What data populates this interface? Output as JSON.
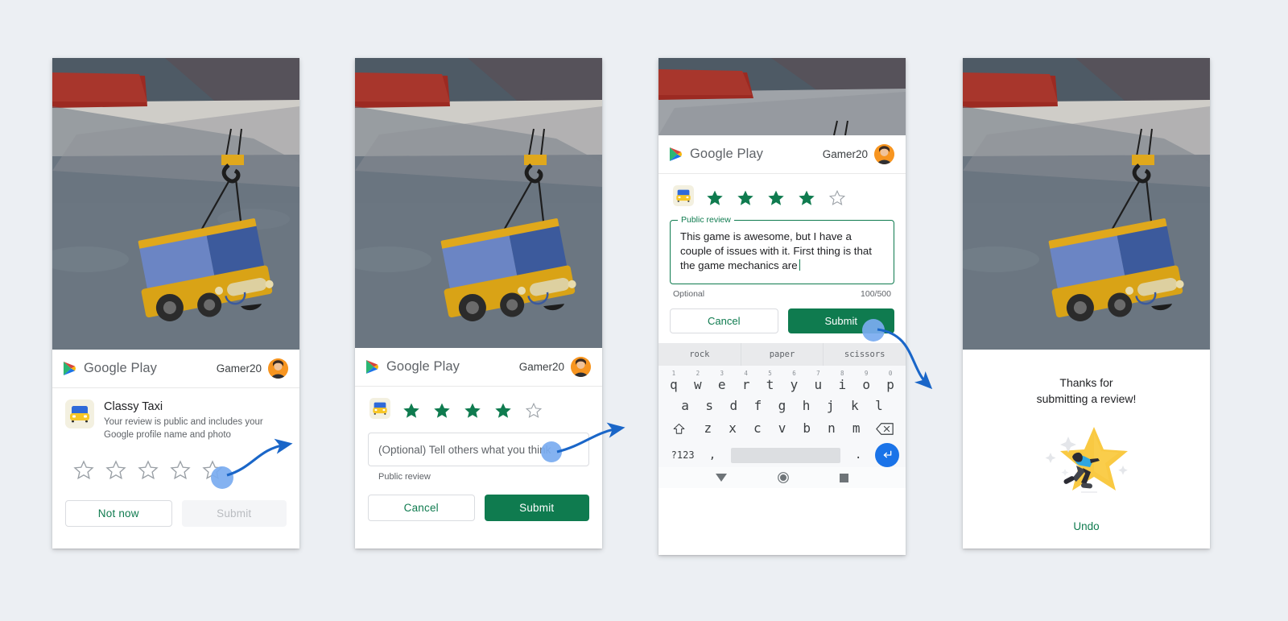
{
  "meta": {
    "accent_green": "#0f7b4f",
    "arrow_blue": "#1a66c8",
    "touch_blue": "#7aabf0",
    "star_gold": "#f9c942",
    "background": "#eceff3"
  },
  "panel1": {
    "name": "rating-prompt",
    "appbar": {
      "brand": "Google Play",
      "username": "Gamer20",
      "logo_icon": "google-play-logo",
      "avatar_icon": "user-avatar"
    },
    "app": {
      "icon": "classy-taxi-app-icon",
      "title": "Classy Taxi",
      "subtitle": "Your review is public and includes your Google profile name and photo"
    },
    "rating": {
      "value": 0,
      "max": 5,
      "stars": [
        "empty",
        "empty",
        "empty",
        "empty",
        "empty"
      ]
    },
    "buttons": {
      "secondary": "Not now",
      "primary": "Submit",
      "primary_disabled": true
    }
  },
  "panel2": {
    "name": "review-entry-empty",
    "appbar": {
      "brand": "Google Play",
      "username": "Gamer20",
      "logo_icon": "google-play-logo",
      "avatar_icon": "user-avatar"
    },
    "rating": {
      "value": 4,
      "max": 5,
      "stars": [
        "filled",
        "filled",
        "filled",
        "filled",
        "empty"
      ],
      "app_icon": "classy-taxi-app-icon"
    },
    "input": {
      "placeholder": "(Optional) Tell others what you think",
      "value": "",
      "helper": "Public review"
    },
    "buttons": {
      "secondary": "Cancel",
      "primary": "Submit"
    }
  },
  "panel3": {
    "name": "review-entry-typing",
    "appbar": {
      "brand": "Google Play",
      "username": "Gamer20",
      "logo_icon": "google-play-logo",
      "avatar_icon": "user-avatar"
    },
    "rating": {
      "value": 4,
      "max": 5,
      "stars": [
        "filled",
        "filled",
        "filled",
        "filled",
        "empty"
      ],
      "app_icon": "classy-taxi-app-icon"
    },
    "field": {
      "label": "Public review",
      "value": "This game is awesome, but I have a couple of issues with it. First thing is that the game mechanics are",
      "helper": "Optional",
      "counter": "100/500"
    },
    "buttons": {
      "secondary": "Cancel",
      "primary": "Submit"
    },
    "keyboard": {
      "suggestions": [
        "rock",
        "paper",
        "scissors"
      ],
      "row1_numbers": [
        "1",
        "2",
        "3",
        "4",
        "5",
        "6",
        "7",
        "8",
        "9",
        "0"
      ],
      "row1": [
        "q",
        "w",
        "e",
        "r",
        "t",
        "y",
        "u",
        "i",
        "o",
        "p"
      ],
      "row2": [
        "a",
        "s",
        "d",
        "f",
        "g",
        "h",
        "j",
        "k",
        "l"
      ],
      "row3": [
        "z",
        "x",
        "c",
        "v",
        "b",
        "n",
        "m"
      ],
      "shift_icon": "shift-key-icon",
      "backspace_icon": "backspace-key-icon",
      "symbols_key": "?123",
      "comma_key": ",",
      "period_key": ".",
      "space_key": "space-bar",
      "enter_icon": "enter-key-icon"
    },
    "navbar": {
      "back_icon": "nav-back-icon",
      "home_icon": "nav-home-icon",
      "recents_icon": "nav-recents-icon"
    }
  },
  "panel4": {
    "name": "review-submitted",
    "title_line1": "Thanks for",
    "title_line2": "submitting a review!",
    "illustration": "star-with-person-illustration",
    "undo": "Undo"
  },
  "annotations": {
    "arrow1": "arrow-panel1-to-panel2",
    "arrow2": "arrow-panel2-to-panel3",
    "arrow3": "arrow-panel3-to-panel4",
    "tap1": "tap-fourth-star",
    "tap2": "tap-review-input",
    "tap3": "tap-submit-button"
  }
}
